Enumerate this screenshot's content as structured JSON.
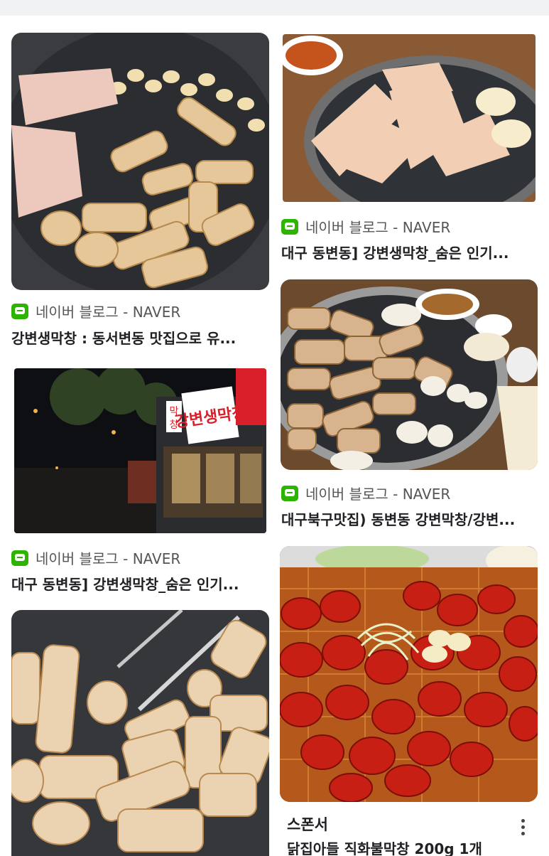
{
  "results": [
    {
      "source": "네이버 블로그 - NAVER",
      "title": "강변생막창 : 동서변동 맛집으로 유..."
    },
    {
      "source": "네이버 블로그 - NAVER",
      "title": "대구 동변동] 강변생막창_숨은 인기..."
    },
    {
      "source": "네이버 블로그 - NAVER",
      "title": "대구 동변동] 강변생막창_숨은 인기..."
    },
    {
      "source": "네이버 블로그 - NAVER",
      "title": "대구북구맛집) 동변동 강변막창/강변..."
    }
  ],
  "ad": {
    "label": "스폰서",
    "product": "닭집아들 직화불막창 200g 1개"
  },
  "storefront_sign": {
    "text": "강변생막창",
    "side": "막창"
  },
  "colors": {
    "naver_green": "#2db400",
    "grill_dark": "#2b2d31"
  }
}
